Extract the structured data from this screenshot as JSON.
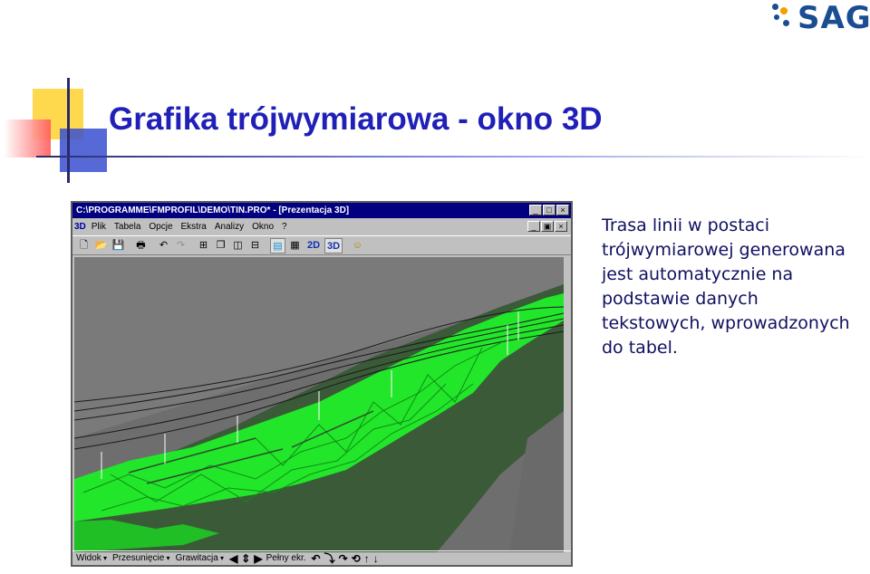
{
  "slide": {
    "title": "Grafika trójwymiarowa - okno 3D",
    "logo_text": "SAG",
    "description": "Trasa linii w postaci trójwymiarowej generowana jest automatycznie na podstawie danych tekstowych, wprowadzonych do tabel."
  },
  "window": {
    "title": "C:\\PROGRAMME\\FMPROFIL\\DEMO\\TIN.PRO* - [Prezentacja 3D]",
    "menu_icon": "3D",
    "menu": [
      "Plik",
      "Tabela",
      "Opcje",
      "Ekstra",
      "Analizy",
      "Okno",
      "?"
    ],
    "toolbar_text_buttons": [
      "2D",
      "3D"
    ],
    "status": {
      "view_label": "Widok",
      "move_label": "Przesunięcie",
      "gravity_label": "Grawitacja",
      "fullscreen_label": "Pełny ekr."
    }
  },
  "colors": {
    "title": "#2020b8",
    "text": "#101060",
    "terrain_green": "#22e62a",
    "ground_dark": "#3a5a38",
    "sky_gray": "#7a7a7a"
  }
}
